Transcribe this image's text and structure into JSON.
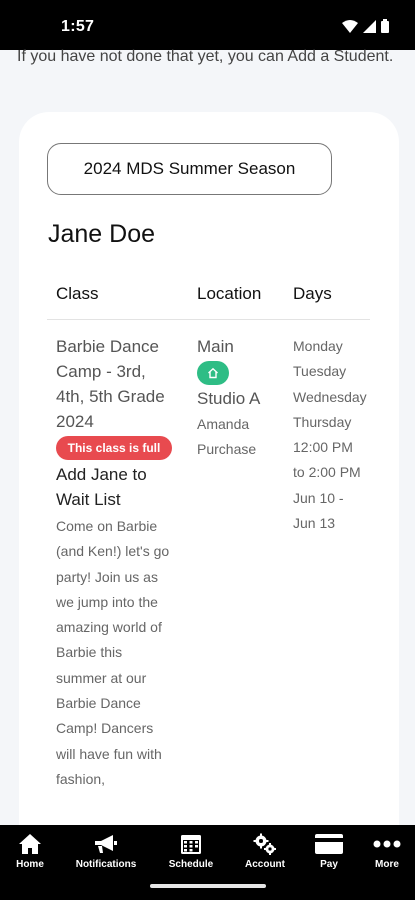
{
  "status_bar": {
    "time": "1:57"
  },
  "intro_text": "If you have not done that yet, you can Add a Student.",
  "season": {
    "button_label": "2024 MDS Summer Season"
  },
  "student": {
    "name": "Jane Doe"
  },
  "table": {
    "headers": [
      "Class",
      "Location",
      "Days"
    ],
    "row": {
      "class_name": "Barbie Dance Camp - 3rd, 4th, 5th Grade 2024",
      "full_badge": "This class is full",
      "waitlist_link": "Add Jane to Wait List",
      "description": "Come on Barbie (and Ken!) let's go party! Join us as we jump into the amazing world of Barbie this summer at our Barbie Dance Camp! Dancers will have fun with fashion,",
      "location": "Main",
      "room": "Studio A",
      "teacher": "Amanda Purchase",
      "days": [
        "Monday",
        "Tuesday",
        "Wednesday",
        "Thursday"
      ],
      "time_start": "12:00 PM",
      "time_end": "to 2:00 PM",
      "dates_start": "Jun 10 -",
      "dates_end": "Jun 13"
    }
  },
  "nav": {
    "items": [
      {
        "label": "Home",
        "icon": "home-icon"
      },
      {
        "label": "Notifications",
        "icon": "megaphone-icon"
      },
      {
        "label": "Schedule",
        "icon": "calendar-icon"
      },
      {
        "label": "Account",
        "icon": "gears-icon"
      },
      {
        "label": "Pay",
        "icon": "credit-card-icon"
      },
      {
        "label": "More",
        "icon": "more-dots-icon"
      }
    ]
  },
  "colors": {
    "badge_red": "#e84a4f",
    "chip_green": "#2ebd85",
    "nav_bg": "#000000"
  }
}
